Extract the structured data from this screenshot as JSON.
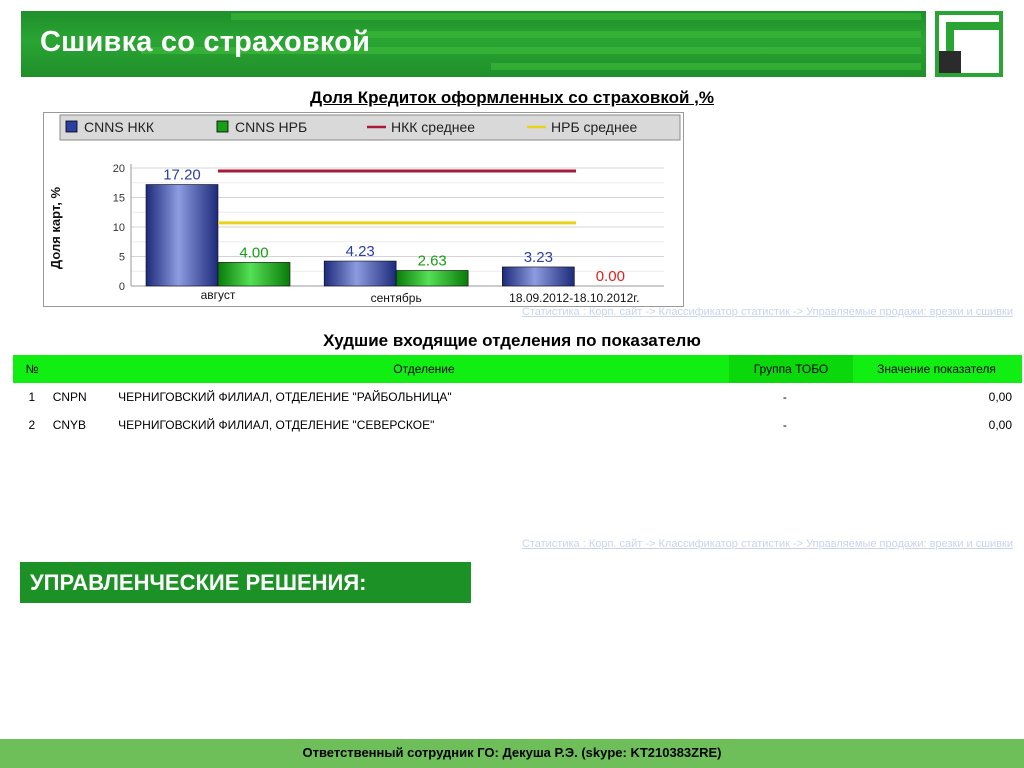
{
  "header": {
    "title": "Сшивка со страховкой"
  },
  "chart_section": {
    "title": "Доля Кредиток оформленных со страховкой ,%",
    "source_link": "Статистика : Корп. сайт -> Классификатор статистик -> Управляемые продажи: врезки и сшивки"
  },
  "chart_data": {
    "type": "bar",
    "title": "",
    "ylabel": "Доля карт, %",
    "xlabel": "",
    "categories": [
      "август",
      "сентябрь",
      "18.09.2012-18.10.2012г."
    ],
    "series": [
      {
        "name": "CNNS НКК",
        "values": [
          17.2,
          4.23,
          3.23
        ],
        "labels": [
          "17.20",
          "4.23",
          "3.23"
        ],
        "color": "#2b3fa3"
      },
      {
        "name": "CNNS НРБ",
        "values": [
          4.0,
          2.63,
          0.0
        ],
        "labels": [
          "4.00",
          "2.63",
          "0.00"
        ],
        "color": "#16a016"
      }
    ],
    "lines": [
      {
        "name": "НКК среднее",
        "value": 19.5,
        "color": "#a8193a"
      },
      {
        "name": "НРБ среднее",
        "value": 10.7,
        "color": "#e8d21a"
      }
    ],
    "yticks": [
      "0",
      "5",
      "10",
      "15",
      "20"
    ],
    "ylim": [
      0,
      20
    ],
    "grid": true,
    "legend": "top"
  },
  "table_section": {
    "title": "Худшие входящие отделения по показателю",
    "headers": [
      "№",
      "Отделение",
      "Группа ТОБО",
      "Значение показателя"
    ],
    "rows": [
      {
        "num": "1",
        "code": "CNPN",
        "name": "ЧЕРНИГОВСКИЙ ФИЛИАЛ, ОТДЕЛЕНИЕ \"РАЙБОЛЬНИЦА\"",
        "group": "-",
        "value": "0,00"
      },
      {
        "num": "2",
        "code": "CNYB",
        "name": "ЧЕРНИГОВСКИЙ ФИЛИАЛ, ОТДЕЛЕНИЕ \"СЕВЕРСКОЕ\"",
        "group": "-",
        "value": "0,00"
      }
    ],
    "source_link": "Статистика : Корп. сайт -> Классификатор статистик -> Управляемые продажи: врезки и сшивки"
  },
  "decisions": {
    "title": "УПРАВЛЕНЧЕСКИЕ РЕШЕНИЯ:"
  },
  "footer": {
    "text": "Ответственный сотрудник ГО: Декуша Р.Э. (skype: KT210383ZRE)"
  }
}
